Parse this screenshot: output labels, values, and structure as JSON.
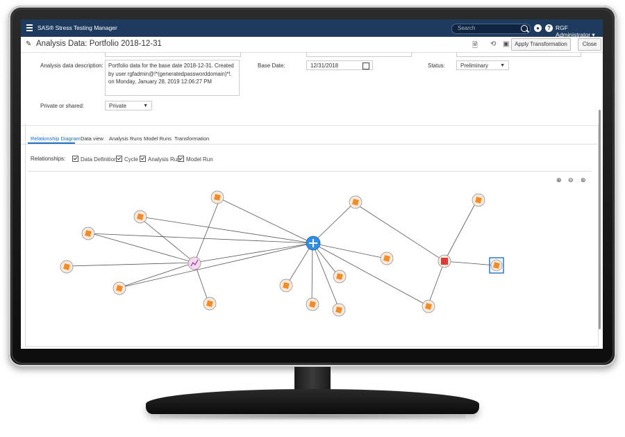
{
  "app": {
    "title": "SAS® Stress Testing Manager",
    "search_placeholder": "Search",
    "user": "RGF Administrator ▾"
  },
  "header": {
    "title": "Analysis Data: Portfolio 2018-12-31",
    "apply_button": "Apply Transformation",
    "close_button": "Close"
  },
  "form": {
    "description_label": "Analysis data description:",
    "description_value": "Portfolio data for the base date 2018-12-31. Created by user rgfadmin@!*(generatedpassworddomain)*!. on Monday, January 28, 2019 12:06:27 PM",
    "base_date_label": "Base Date:",
    "base_date_value": "12/31/2018",
    "status_label": "Status:",
    "status_value": "Preliminary",
    "private_label": "Private or shared:",
    "private_value": "Private"
  },
  "tabs": [
    "Relationship Diagram",
    "Data view",
    "Analysis Runs",
    "Model Runs",
    "Transformation"
  ],
  "relationships": {
    "label": "Relationships:",
    "items": [
      "Data Definition",
      "Cycle",
      "Analysis Run",
      "Model Run"
    ]
  },
  "colors": {
    "topbar": "#1e3a5f",
    "accent": "#1f6fc5",
    "node_orange": "#f28c28",
    "node_fill": "#fbe9dc",
    "hub_blue": "#2f8fe0",
    "red_node": "#d93a3a"
  },
  "icons": [
    "menu-icon",
    "search-icon",
    "bell-icon",
    "help-icon",
    "document-icon",
    "history-icon",
    "save-icon",
    "zoom-in-icon",
    "zoom-out-icon",
    "zoom-fit-icon"
  ]
}
